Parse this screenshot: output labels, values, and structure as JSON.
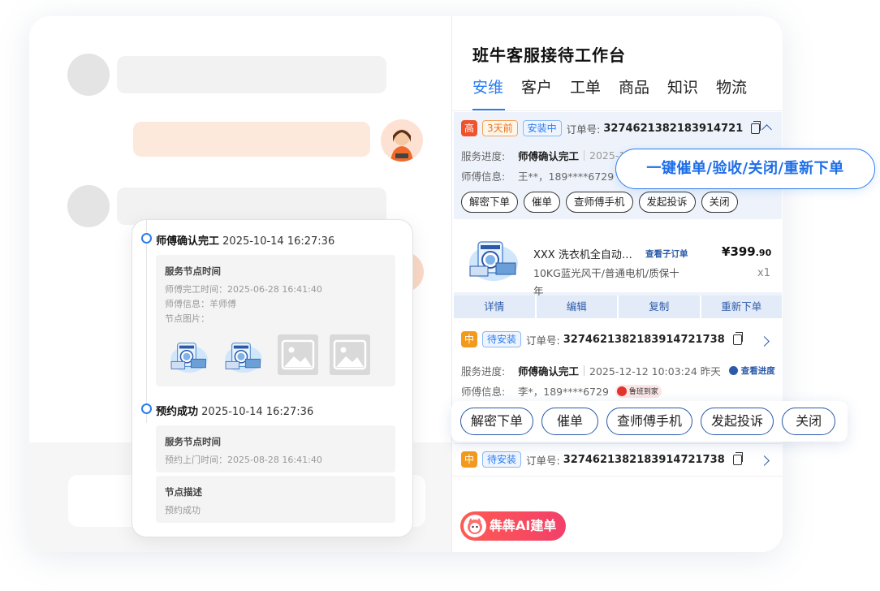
{
  "panel": {
    "title": "班牛客服接待工作台",
    "tabs": [
      "安维",
      "客户",
      "工单",
      "商品",
      "知识",
      "物流"
    ]
  },
  "order1": {
    "priority": "高",
    "priority_color": "#f0522d",
    "tag_time": "3天前",
    "tag_status": "安装中",
    "order_label": "订单号:",
    "order_no": "3274621382183914721",
    "progress_label": "服务进度:",
    "progress_value": "师傅确认完工",
    "progress_time": "2025-1",
    "master_label": "师傅信息:",
    "master_value": "王**，189****6729",
    "actions": [
      "解密下单",
      "催单",
      "查师傅手机",
      "发起投诉",
      "关闭"
    ],
    "product_name": "XXX 洗衣机全自动…",
    "sub_order_link": "查看子订单",
    "price_symbol": "¥",
    "price_int": "399",
    "price_dec": ".90",
    "product_spec": "10KG蓝光风干/普通电机/质保十年",
    "quantity": "x1",
    "bottom_actions": [
      "详情",
      "编辑",
      "复制",
      "重新下单"
    ]
  },
  "order2": {
    "priority": "中",
    "priority_color": "#f39a1e",
    "tag_status": "待安装",
    "order_label": "订单号:",
    "order_no": "3274621382183914721738",
    "progress_label": "服务进度:",
    "progress_value": "师傅确认完工",
    "progress_time": "2025-12-12 10:03:24 昨天",
    "progress_link": "查看进度",
    "master_label": "师傅信息:",
    "master_value": "李*，189****6729",
    "master_badge": "鲁班到家"
  },
  "order3": {
    "priority": "中",
    "tag_status": "待安装",
    "order_label": "订单号:",
    "order_no": "3274621382183914721738"
  },
  "callout": "一键催单/验收/关闭/重新下单",
  "big_actions": [
    "解密下单",
    "催单",
    "查师傅手机",
    "发起投诉",
    "关闭"
  ],
  "ai_button": "犇犇AI建单",
  "timeline": [
    {
      "title": "师傅确认完工",
      "time": "2025-10-14 16:27:36",
      "box_title": "服务节点时间",
      "lines": [
        "师傅完工时间：2025-06-28 16:41:40",
        "师傅信息：羊师傅",
        "节点图片："
      ]
    },
    {
      "title": "预约成功",
      "time": "2025-10-14 16:27:36",
      "box_title": "服务节点时间",
      "lines": [
        "预约上门时间：2025-08-28 16:41:40"
      ],
      "box2_title": "节点描述",
      "box2_lines": [
        "预约成功"
      ]
    }
  ]
}
